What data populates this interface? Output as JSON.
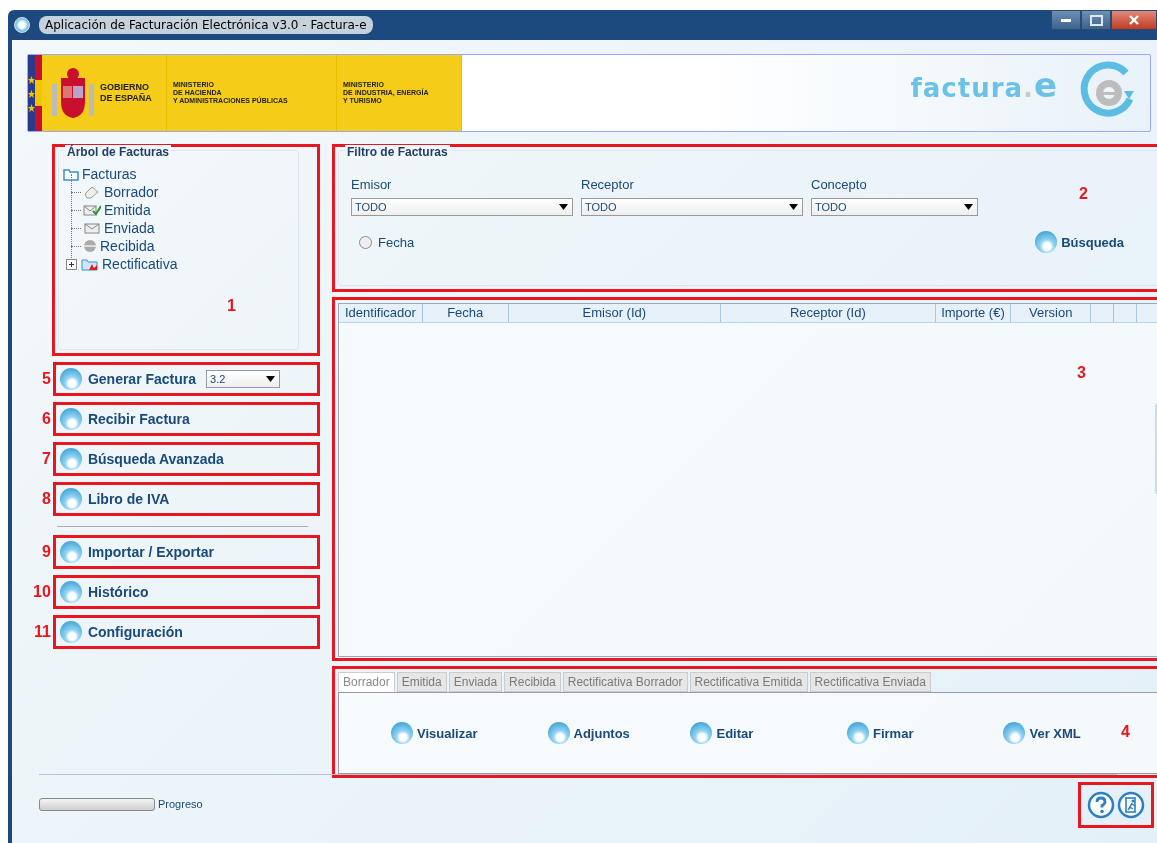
{
  "window": {
    "title": "Aplicación de Facturación Electrónica v3.0 - Factura-e"
  },
  "banner": {
    "gobierno": [
      "GOBIERNO",
      "DE ESPAÑA"
    ],
    "ministerio_1": [
      "MINISTERIO",
      "DE HACIENDA",
      "Y ADMINISTRACIONES PÚBLICAS"
    ],
    "ministerio_2": [
      "MINISTERIO",
      "DE INDUSTRIA, ENERGÍA",
      "Y TURISMO"
    ],
    "logo_text": "factura",
    "logo_dot": ".",
    "logo_e": "e"
  },
  "tree": {
    "title": "Árbol de Facturas",
    "callout": "1",
    "root": {
      "label": "Facturas",
      "children": [
        {
          "label": "Borrador",
          "kind": "eraser"
        },
        {
          "label": "Emitida",
          "kind": "sent-check"
        },
        {
          "label": "Enviada",
          "kind": "envelope"
        },
        {
          "label": "Recibida",
          "kind": "seal"
        },
        {
          "label": "Rectificativa",
          "kind": "folder",
          "expanded": false
        }
      ]
    }
  },
  "nav": [
    {
      "label": "Generar Factura",
      "callout": "5",
      "version": "3.2"
    },
    {
      "label": "Recibir Factura",
      "callout": "6"
    },
    {
      "label": "Búsqueda Avanzada",
      "callout": "7"
    },
    {
      "label": "Libro de IVA",
      "callout": "8"
    },
    {
      "label": "Importar / Exportar",
      "callout": "9",
      "separator_before": true
    },
    {
      "label": "Histórico",
      "callout": "10"
    },
    {
      "label": "Configuración",
      "callout": "11"
    }
  ],
  "filter": {
    "title": "Filtro de Facturas",
    "callout": "2",
    "fields": [
      {
        "label": "Emisor",
        "value": "TODO"
      },
      {
        "label": "Receptor",
        "value": "TODO"
      },
      {
        "label": "Concepto",
        "value": "TODO"
      }
    ],
    "date": {
      "label": "Fecha",
      "checked": false
    },
    "search_button": "Búsqueda"
  },
  "table": {
    "callout": "3",
    "columns": [
      "Identificador",
      "Fecha",
      "Emisor (Id)",
      "Receptor (Id)",
      "Importe (€)",
      "Version"
    ]
  },
  "actions": {
    "callout": "4",
    "tabs": [
      {
        "label": "Borrador",
        "selected": true,
        "disabled": false
      },
      {
        "label": "Emitida",
        "selected": false,
        "disabled": true
      },
      {
        "label": "Enviada",
        "selected": false,
        "disabled": true
      },
      {
        "label": "Recibida",
        "selected": false,
        "disabled": true
      },
      {
        "label": "Rectificativa Borrador",
        "selected": false,
        "disabled": true
      },
      {
        "label": "Rectificativa Emitida",
        "selected": false,
        "disabled": true
      },
      {
        "label": "Rectificativa Enviada",
        "selected": false,
        "disabled": true
      }
    ],
    "buttons": [
      "Visualizar",
      "Adjuntos",
      "Editar",
      "Firmar",
      "Ver XML"
    ]
  },
  "status_bar": {
    "progress": {
      "label": "Progreso",
      "level": 0
    }
  }
}
